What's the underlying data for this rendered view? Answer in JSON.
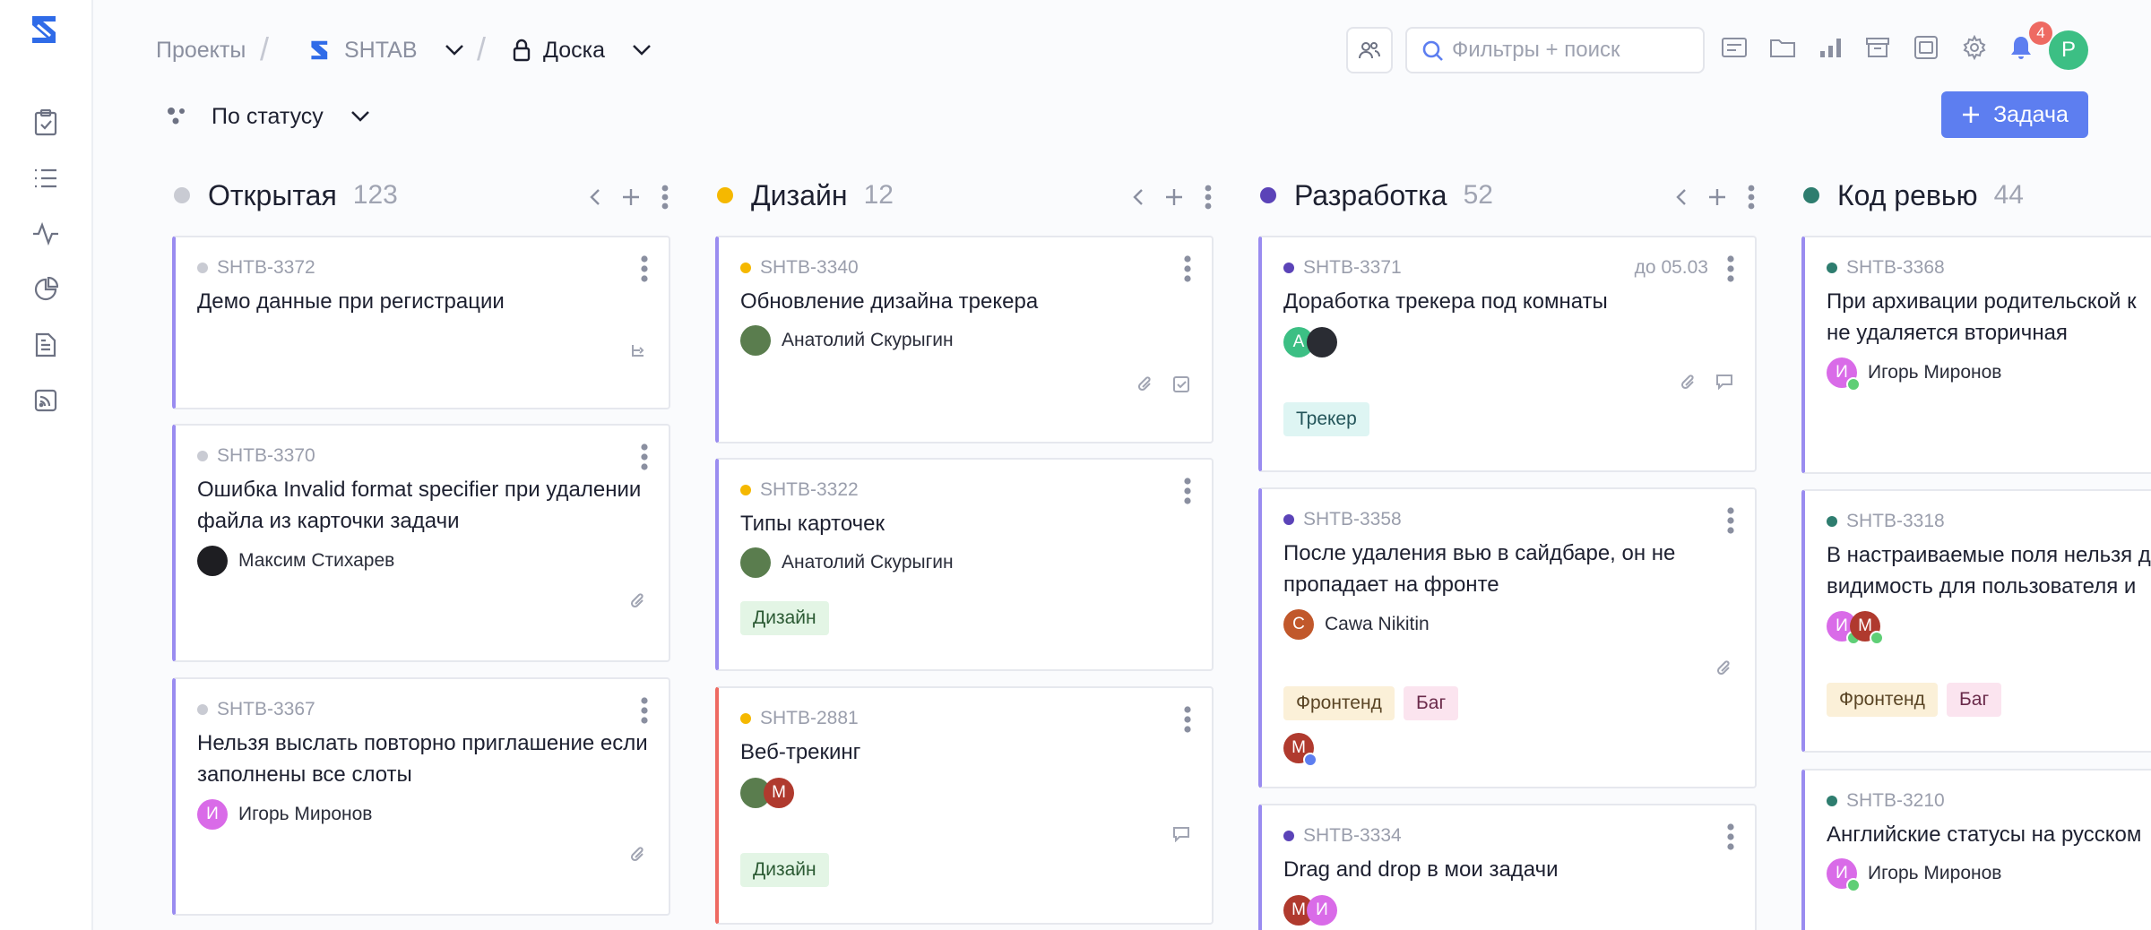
{
  "breadcrumb": {
    "projects": "Проекты",
    "project": "SHTAB",
    "board": "Доска"
  },
  "search": {
    "placeholder": "Фильтры + поиск"
  },
  "notifications": {
    "count": "4"
  },
  "user": {
    "initial": "P"
  },
  "grouping": {
    "label": "По статусу"
  },
  "add_task": {
    "label": "Задача"
  },
  "columns": [
    {
      "title": "Открытая",
      "count": "123",
      "color": "#c9cbd3",
      "cards": [
        {
          "key": "SHTB-3372",
          "title": "Демо данные при регистрации"
        },
        {
          "key": "SHTB-3370",
          "title": "Ошибка Invalid format specifier при удалении файла из карточки задачи",
          "assignee": "Максим Стихарев"
        },
        {
          "key": "SHTB-3367",
          "title": "Нельзя выслать повторно приглашение если заполнены все слоты",
          "assignee": "Игорь Миронов",
          "avatar": "И"
        }
      ]
    },
    {
      "title": "Дизайн",
      "count": "12",
      "color": "#f5b800",
      "cards": [
        {
          "key": "SHTB-3340",
          "title": "Обновление дизайна трекера",
          "assignee": "Анатолий Скурыгин"
        },
        {
          "key": "SHTB-3322",
          "title": "Типы карточек",
          "assignee": "Анатолий Скурыгин",
          "tag": "Дизайн"
        },
        {
          "key": "SHTB-2881",
          "title": "Веб-трекинг",
          "avatar2": "М",
          "tag": "Дизайн"
        }
      ]
    },
    {
      "title": "Разработка",
      "count": "52",
      "color": "#5b43b8",
      "cards": [
        {
          "key": "SHTB-3371",
          "due": "до 05.03",
          "title": "Доработка трекера под комнаты",
          "avatar": "А",
          "tag": "Трекер"
        },
        {
          "key": "SHTB-3358",
          "title": "После удаления вью в сайдбаре, он не пропадает на фронте",
          "assignee": "Cawa Nikitin",
          "avatar": "С",
          "tags": [
            "Фронтенд",
            "Баг"
          ],
          "avatar2": "М"
        },
        {
          "key": "SHTB-3334",
          "title": "Drag and drop в мои задачи",
          "avatars": [
            "М",
            "И"
          ]
        }
      ]
    },
    {
      "title": "Код ревью",
      "count": "44",
      "color": "#2e7d6f",
      "cards": [
        {
          "key": "SHTB-3368",
          "title": "При архивации родительской к",
          "title2": "не удаляется вторичная",
          "assignee": "Игорь Миронов",
          "avatar": "И"
        },
        {
          "key": "SHTB-3318",
          "title": "В настраиваемые поля нельзя д",
          "title2": "видимость для пользователя и",
          "avatars": [
            "И",
            "М"
          ],
          "tags": [
            "Фронтенд",
            "Баг"
          ]
        },
        {
          "key": "SHTB-3210",
          "title": "Английские статусы на русском",
          "assignee": "Игорь Миронов",
          "avatar": "И"
        }
      ]
    }
  ]
}
